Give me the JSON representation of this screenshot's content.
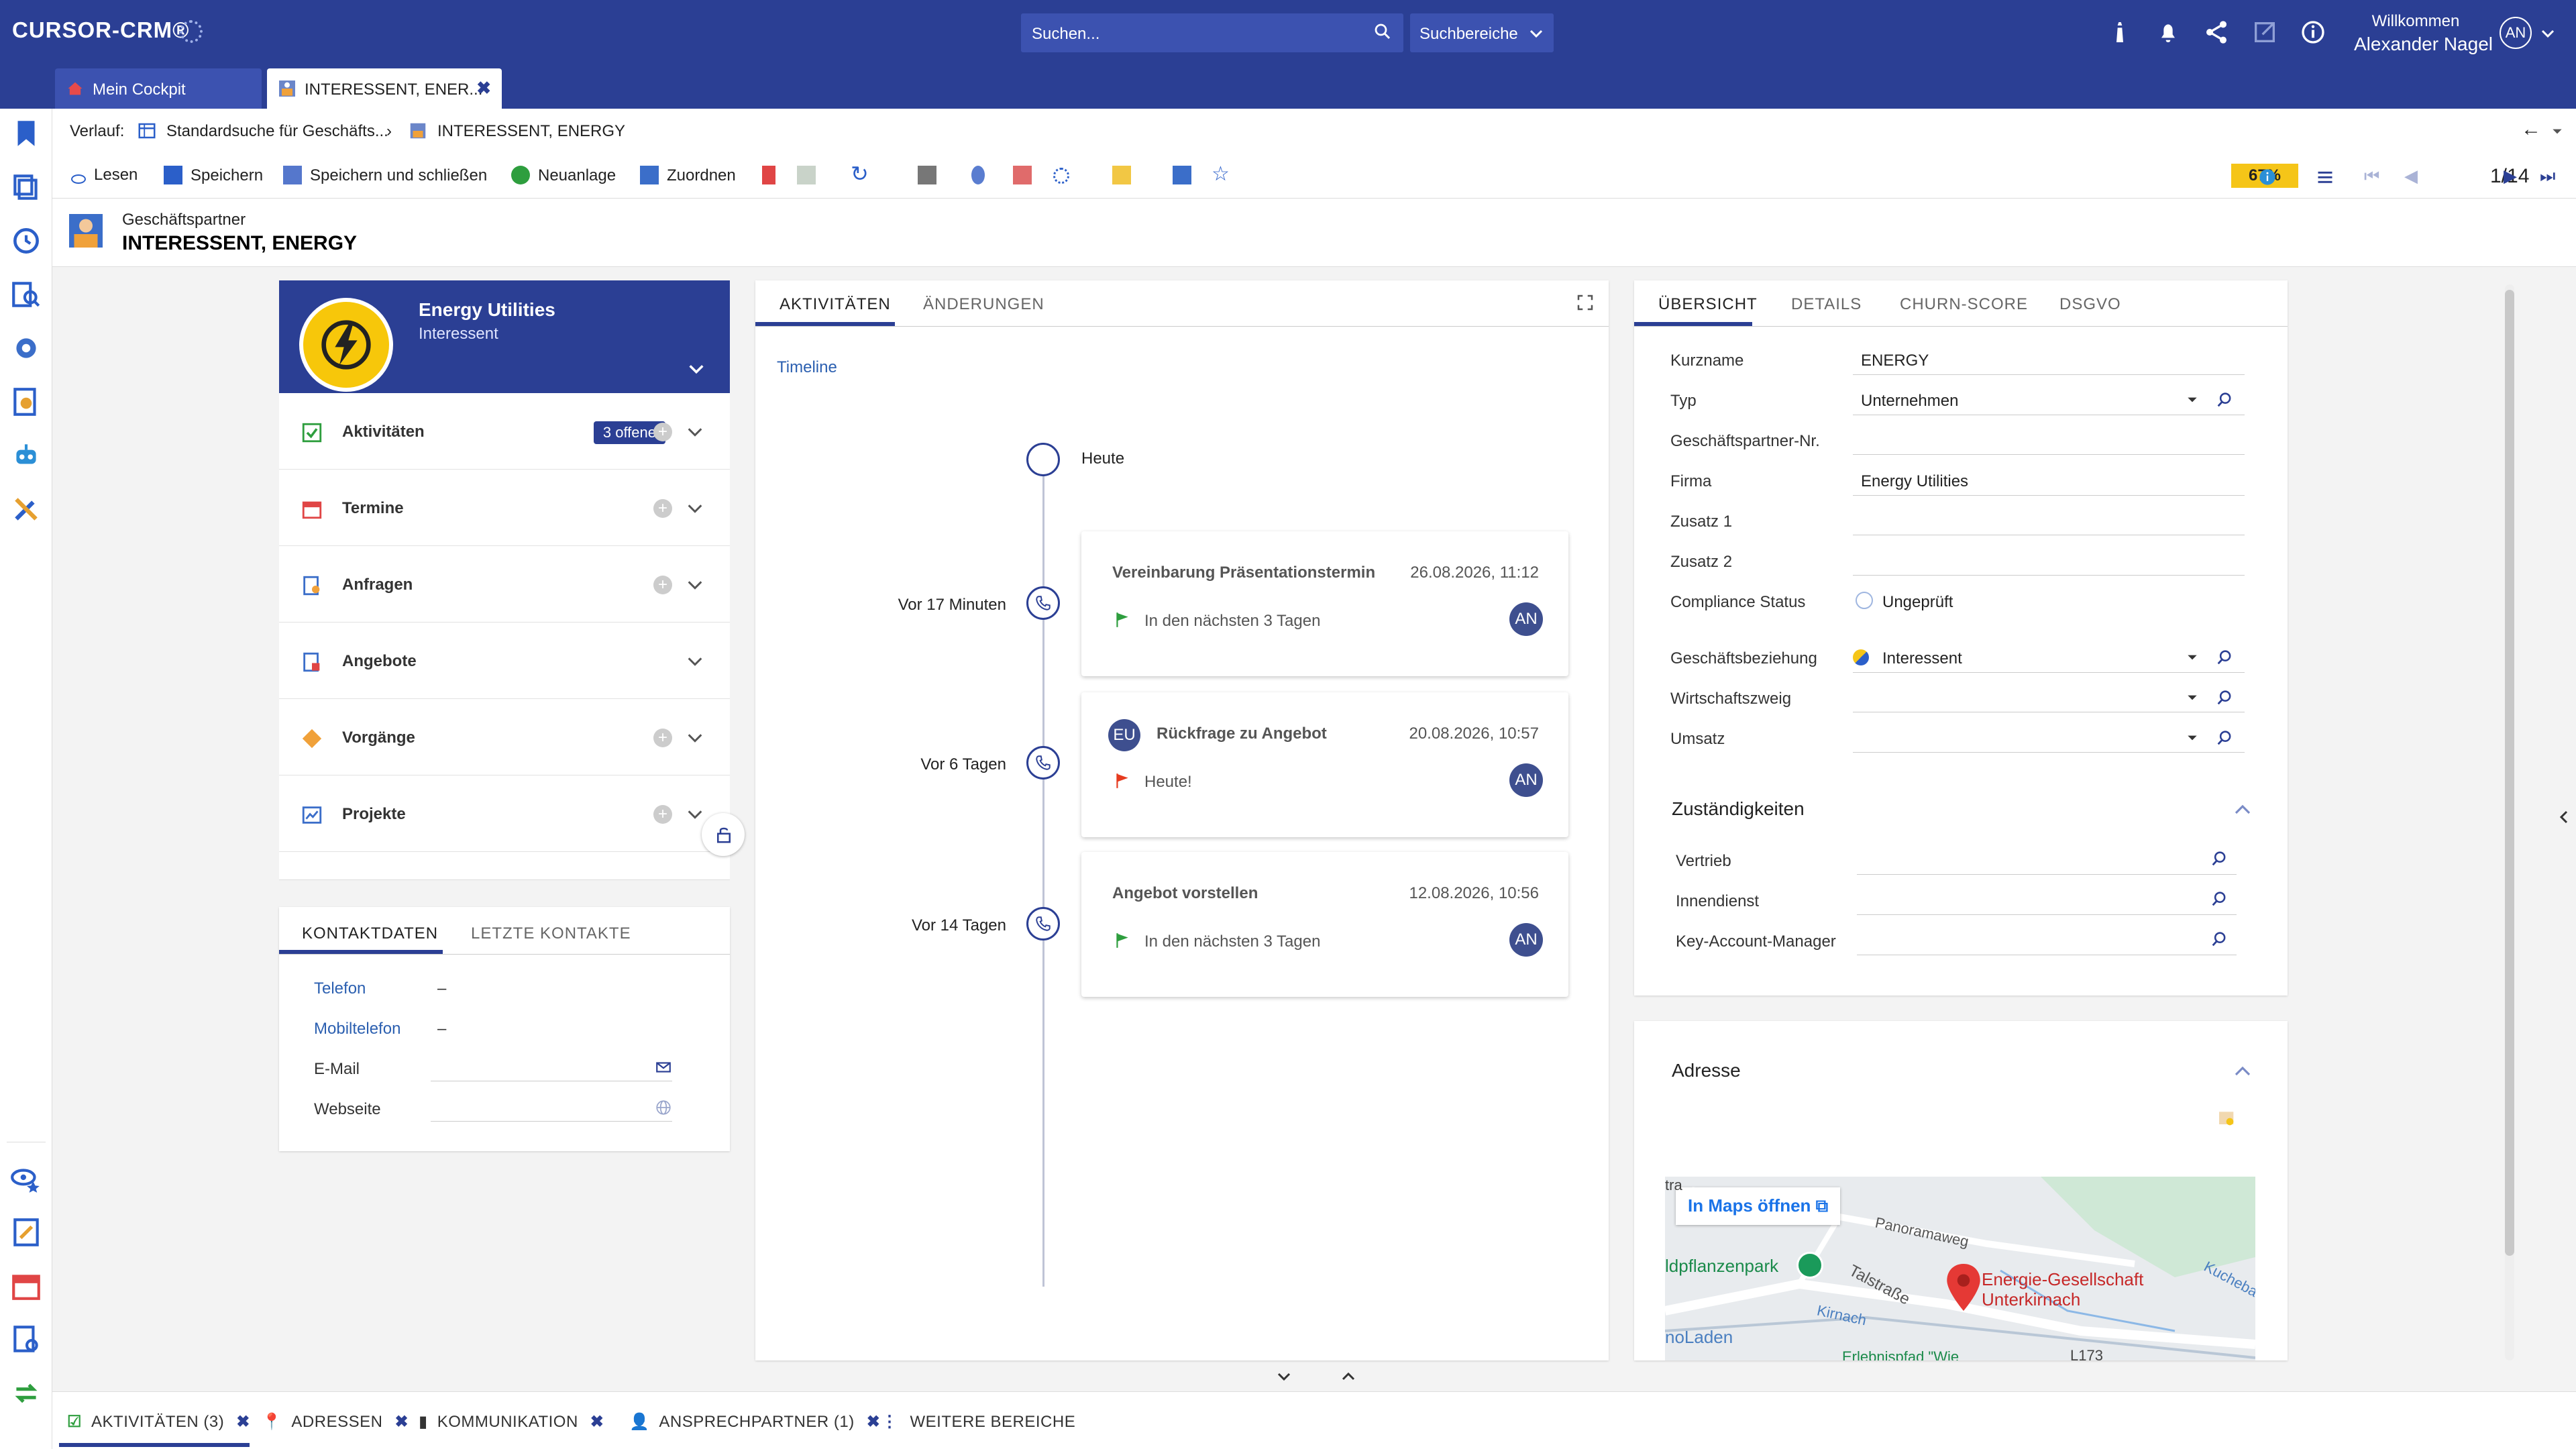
{
  "header": {
    "logo": "CURSOR-CRM®",
    "search_placeholder": "Suchen...",
    "search_area": "Suchbereiche",
    "welcome": "Willkommen",
    "user": "Alexander Nagel",
    "user_initials": "AN"
  },
  "tabs": [
    {
      "label": "Mein Cockpit"
    },
    {
      "label": "INTERESSENT, ENER..."
    }
  ],
  "breadcrumb": {
    "prefix": "Verlauf:",
    "items": [
      "Standardsuche für Geschäfts...",
      "INTERESSENT, ENERGY"
    ]
  },
  "toolbar": {
    "read": "Lesen",
    "save": "Speichern",
    "save_close": "Speichern und schließen",
    "new": "Neuanlage",
    "assign": "Zuordnen",
    "progress": "67%",
    "pager": "1/14"
  },
  "object": {
    "type": "Geschäftspartner",
    "name": "INTERESSENT, ENERGY"
  },
  "company": {
    "name": "Energy Utilities",
    "status": "Interessent"
  },
  "sections": [
    {
      "label": "Aktivitäten",
      "badge": "3 offene"
    },
    {
      "label": "Termine"
    },
    {
      "label": "Anfragen"
    },
    {
      "label": "Angebote"
    },
    {
      "label": "Vorgänge"
    },
    {
      "label": "Projekte"
    }
  ],
  "contact": {
    "tabs": [
      "KONTAKTDATEN",
      "LETZTE KONTAKTE"
    ],
    "rows": [
      {
        "label": "Telefon",
        "value": "–"
      },
      {
        "label": "Mobiltelefon",
        "value": "–"
      },
      {
        "label": "E-Mail",
        "value": ""
      },
      {
        "label": "Webseite",
        "value": ""
      }
    ]
  },
  "middle": {
    "tabs": [
      "AKTIVITÄTEN",
      "ÄNDERUNGEN"
    ],
    "timeline_label": "Timeline",
    "today": "Heute",
    "items": [
      {
        "ago": "Vor 17 Minuten",
        "title": "Vereinbarung Präsentationstermin",
        "date": "26.08.2026, 11:12",
        "sub": "In den nächsten 3 Tagen",
        "avatar": "AN",
        "flag": "green"
      },
      {
        "ago": "Vor 6 Tagen",
        "title": "Rückfrage zu Angebot",
        "date": "20.08.2026, 10:57",
        "sub": "Heute!",
        "avatar": "AN",
        "flag": "red",
        "badge": "EU"
      },
      {
        "ago": "Vor 14 Tagen",
        "title": "Angebot vorstellen",
        "date": "12.08.2026, 10:56",
        "sub": "In den nächsten 3 Tagen",
        "avatar": "AN",
        "flag": "green"
      }
    ]
  },
  "right": {
    "tabs": [
      "ÜBERSICHT",
      "DETAILS",
      "CHURN-SCORE",
      "DSGVO"
    ],
    "fields": [
      {
        "label": "Kurzname",
        "value": "ENERGY"
      },
      {
        "label": "Typ",
        "value": "Unternehmen"
      },
      {
        "label": "Geschäftspartner-Nr.",
        "value": ""
      },
      {
        "label": "Firma",
        "value": "Energy Utilities"
      },
      {
        "label": "Zusatz 1",
        "value": ""
      },
      {
        "label": "Zusatz 2",
        "value": ""
      },
      {
        "label": "Compliance Status",
        "value": "Ungeprüft"
      },
      {
        "label": "Geschäftsbeziehung",
        "value": "Interessent"
      },
      {
        "label": "Wirtschaftszweig",
        "value": ""
      },
      {
        "label": "Umsatz",
        "value": ""
      }
    ],
    "responsibilities_title": "Zuständigkeiten",
    "responsibilities": [
      "Vertrieb",
      "Innendienst",
      "Key-Account-Manager"
    ],
    "address_title": "Adresse",
    "map": {
      "open_maps": "In Maps öffnen",
      "labels": [
        "Panoramaweg",
        "Talstraße",
        "ldpflanzenpark",
        "Kirnach",
        "Kucheba",
        "noLaden",
        "Erlebnispfad \"Wie",
        "L173",
        "Energie-Gesellschaft",
        "Unterkirnach",
        "tra"
      ]
    }
  },
  "bottom_tabs": [
    {
      "label": "AKTIVITÄTEN (3)"
    },
    {
      "label": "ADRESSEN"
    },
    {
      "label": "KOMMUNIKATION"
    },
    {
      "label": "ANSPRECHPARTNER (1)"
    },
    {
      "label": "WEITERE BEREICHE"
    }
  ],
  "colors": {
    "primary": "#2b3f94",
    "accent_yellow": "#f5c518",
    "flag_green": "#2e9e3e",
    "flag_red": "#e63b1f"
  }
}
